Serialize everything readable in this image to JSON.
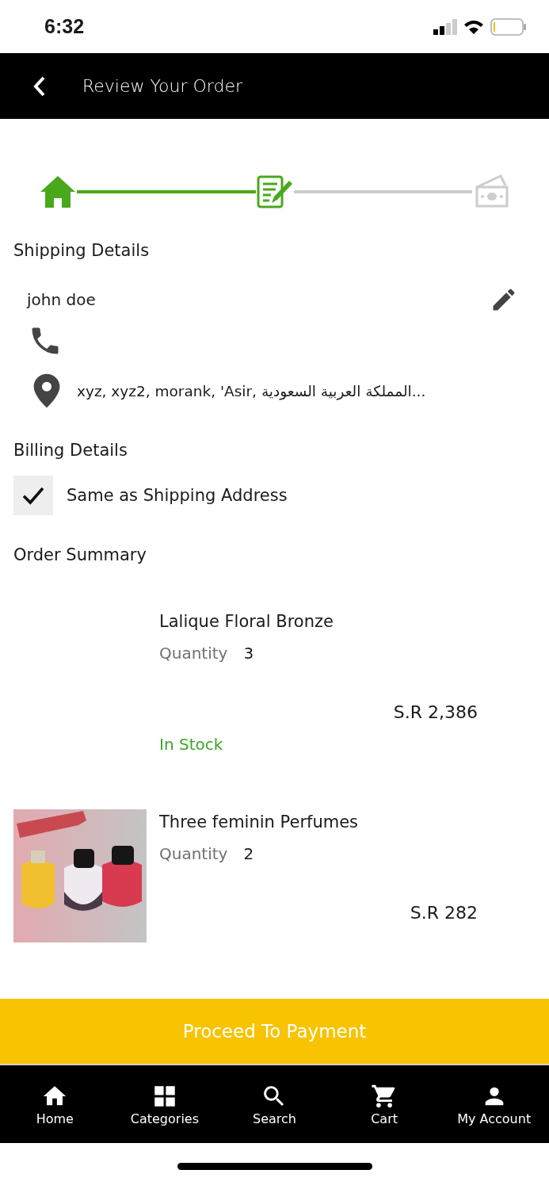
{
  "status_bar": {
    "time": "6:32"
  },
  "header": {
    "title": "Review Your Order"
  },
  "stepper": [
    {
      "kind": "home",
      "reached": true
    },
    {
      "kind": "form",
      "reached": true
    },
    {
      "kind": "money",
      "reached": false
    }
  ],
  "shipping": {
    "heading": "Shipping Details",
    "name": "john doe",
    "address": "xyz, xyz2, morank, 'Asir, المملكة العربية السعودية..."
  },
  "billing": {
    "heading": "Billing Details",
    "same_as_shipping": {
      "label": "Same as Shipping Address",
      "checked": true
    }
  },
  "order_summary": {
    "heading": "Order Summary",
    "items": [
      {
        "name": "Lalique Floral Bronze",
        "quantity_label": "Quantity",
        "quantity": "3",
        "price": "S.R 2,386",
        "stock": "In Stock"
      },
      {
        "name": "Three feminin Perfumes",
        "quantity_label": "Quantity",
        "quantity": "2",
        "price": "S.R 282"
      }
    ]
  },
  "proceed_button": "Proceed To Payment",
  "tab_bar": [
    {
      "label": "Home"
    },
    {
      "label": "Categories"
    },
    {
      "label": "Search"
    },
    {
      "label": "Cart"
    },
    {
      "label": "My Account"
    }
  ]
}
